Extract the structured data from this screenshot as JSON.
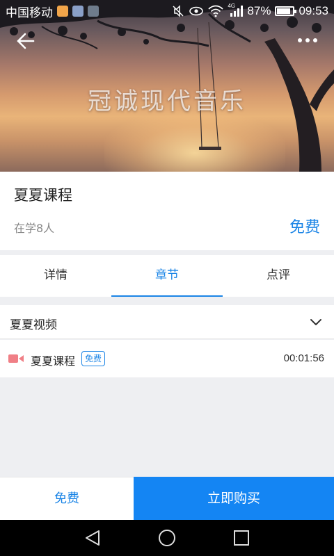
{
  "status_bar": {
    "carrier": "中国移动",
    "network": "4G",
    "battery": "87%",
    "battery_level": 0.87,
    "time": "09:53"
  },
  "hero": {
    "title": "冠诚现代音乐"
  },
  "course": {
    "title": "夏夏课程",
    "learners": "在学8人",
    "price": "免费"
  },
  "tabs": [
    {
      "label": "详情",
      "active": false
    },
    {
      "label": "章节",
      "active": true
    },
    {
      "label": "点评",
      "active": false
    }
  ],
  "chapter": {
    "name": "夏夏视频",
    "lessons": [
      {
        "title": "夏夏课程",
        "badge": "免费",
        "duration": "00:01:56"
      }
    ]
  },
  "bottom_bar": {
    "free_label": "免费",
    "buy_label": "立即购买"
  },
  "colors": {
    "accent": "#1a84e6",
    "buy_button": "#1485f3",
    "video_icon": "#f07f86"
  }
}
